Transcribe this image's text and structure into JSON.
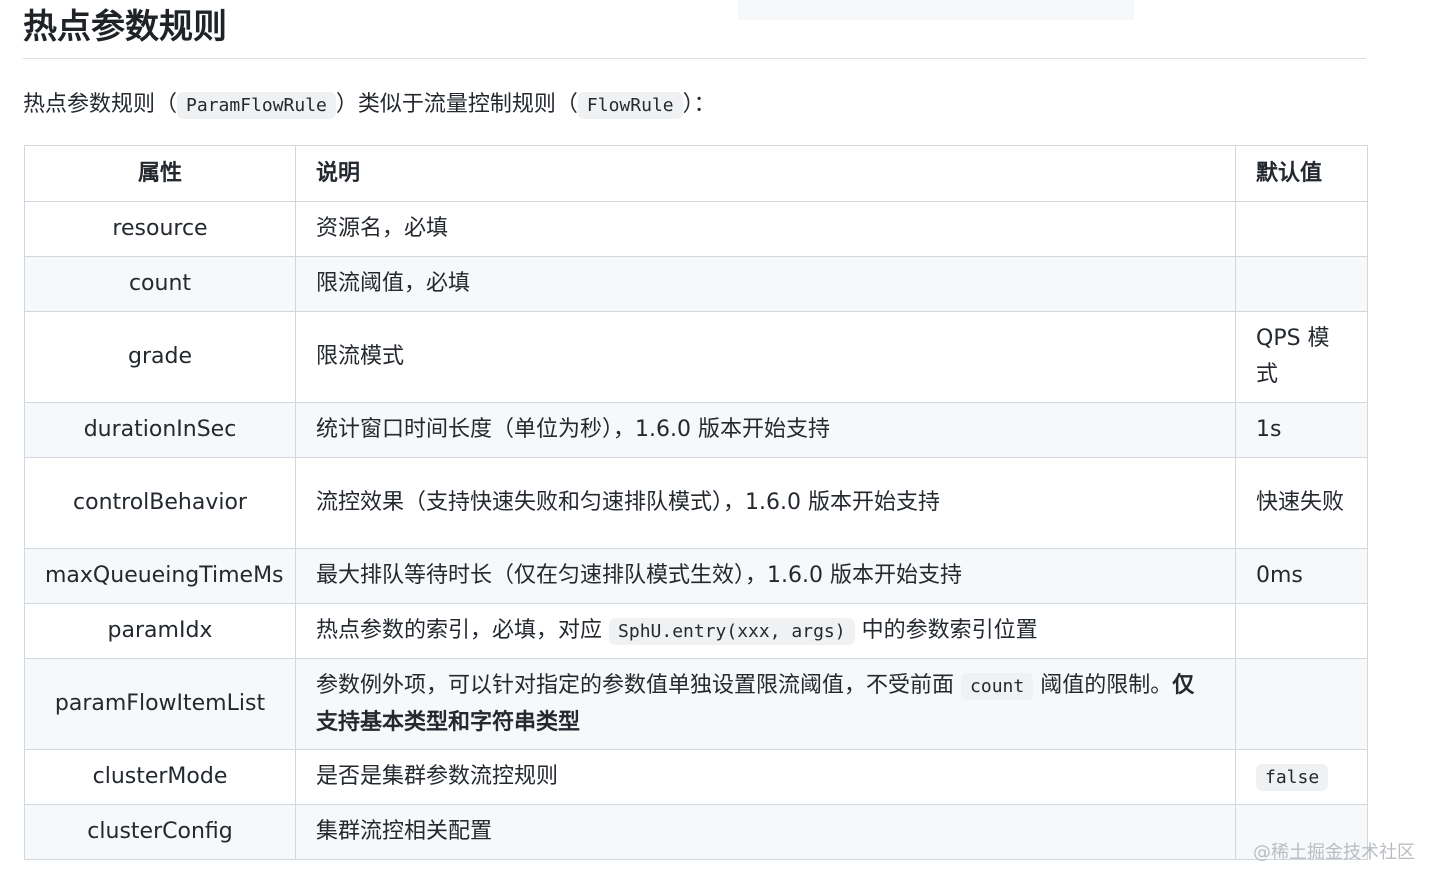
{
  "page_title": "热点参数规则",
  "intro": {
    "text_before": "热点参数规则（",
    "code1": "ParamFlowRule",
    "text_middle": "）类似于流量控制规则（",
    "code2": "FlowRule",
    "text_after": "）："
  },
  "table": {
    "headers": [
      "属性",
      "说明",
      "默认值"
    ],
    "rows": [
      {
        "prop": "resource",
        "desc": "资源名，必填",
        "default": ""
      },
      {
        "prop": "count",
        "desc": "限流阈值，必填",
        "default": ""
      },
      {
        "prop": "grade",
        "desc": "限流模式",
        "default": "QPS 模式"
      },
      {
        "prop": "durationInSec",
        "desc": "统计窗口时间长度（单位为秒），1.6.0 版本开始支持",
        "default": "1s"
      },
      {
        "prop": "controlBehavior",
        "desc": "流控效果（支持快速失败和匀速排队模式），1.6.0 版本开始支持",
        "default": "快速失败"
      },
      {
        "prop": "maxQueueingTimeMs",
        "desc": "最大排队等待时长（仅在匀速排队模式生效），1.6.0 版本开始支持",
        "default": "0ms"
      },
      {
        "prop": "paramIdx",
        "desc_before": "热点参数的索引，必填，对应",
        "desc_code": "SphU.entry(xxx, args)",
        "desc_after": "中的参数索引位置",
        "default": ""
      },
      {
        "prop": "paramFlowItemList",
        "desc_before": "参数例外项，可以针对指定的参数值单独设置限流阈值，不受前面",
        "desc_code": "count",
        "desc_after": "阈值的限制。",
        "desc_bold": "仅支持基本类型和字符串类型",
        "default": ""
      },
      {
        "prop": "clusterMode",
        "desc": "是否是集群参数流控规则",
        "default_code": "false"
      },
      {
        "prop": "clusterConfig",
        "desc": "集群流控相关配置",
        "default": ""
      }
    ]
  },
  "watermark": "@稀土掘金技术社区"
}
